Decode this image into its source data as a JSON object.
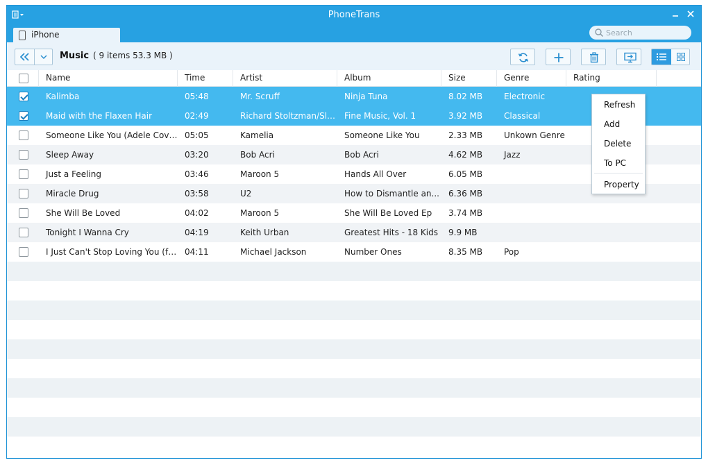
{
  "app": {
    "title": "PhoneTrans"
  },
  "device_tab": {
    "label": "iPhone"
  },
  "search": {
    "placeholder": "Search"
  },
  "toolbar": {
    "title": "Music",
    "info": "( 9 items 53.3 MB )"
  },
  "columns": [
    "Name",
    "Time",
    "Artist",
    "Album",
    "Size",
    "Genre",
    "Rating"
  ],
  "rows": [
    {
      "checked": true,
      "selected": true,
      "name": "Kalimba",
      "time": "05:48",
      "artist": "Mr. Scruff",
      "album": "Ninja Tuna",
      "size": "8.02 MB",
      "genre": "Electronic",
      "rating": ""
    },
    {
      "checked": true,
      "selected": true,
      "name": "Maid with the Flaxen Hair",
      "time": "02:49",
      "artist": "Richard Stoltzman/Slo...",
      "album": "Fine Music, Vol. 1",
      "size": "3.92 MB",
      "genre": "Classical",
      "rating": ""
    },
    {
      "checked": false,
      "selected": false,
      "name": "Someone Like You (Adele Cover)",
      "time": "05:05",
      "artist": "Kamelia",
      "album": "Someone Like You",
      "size": "2.33 MB",
      "genre": "Unkown Genre",
      "rating": ""
    },
    {
      "checked": false,
      "selected": false,
      "name": "Sleep Away",
      "time": "03:20",
      "artist": "Bob Acri",
      "album": "Bob Acri",
      "size": "4.62 MB",
      "genre": "Jazz",
      "rating": ""
    },
    {
      "checked": false,
      "selected": false,
      "name": "Just a Feeling",
      "time": "03:46",
      "artist": "Maroon 5",
      "album": "Hands All Over",
      "size": "6.05 MB",
      "genre": "",
      "rating": ""
    },
    {
      "checked": false,
      "selected": false,
      "name": "Miracle Drug",
      "time": "03:58",
      "artist": "U2",
      "album": "How to Dismantle an...",
      "size": "6.36 MB",
      "genre": "",
      "rating": ""
    },
    {
      "checked": false,
      "selected": false,
      "name": "She Will Be Loved",
      "time": "04:02",
      "artist": "Maroon 5",
      "album": "She Will Be Loved Ep",
      "size": "3.74 MB",
      "genre": "",
      "rating": ""
    },
    {
      "checked": false,
      "selected": false,
      "name": "Tonight I Wanna Cry",
      "time": "04:19",
      "artist": "Keith Urban",
      "album": "Greatest Hits - 18 Kids",
      "size": "9.9 MB",
      "genre": "",
      "rating": ""
    },
    {
      "checked": false,
      "selected": false,
      "name": "I Just Can't Stop Loving You (fea...",
      "time": "04:11",
      "artist": "Michael Jackson",
      "album": "Number Ones",
      "size": "8.35 MB",
      "genre": "Pop",
      "rating": ""
    }
  ],
  "context_menu": {
    "items": [
      "Refresh",
      "Add",
      "Delete",
      "To PC",
      "Property"
    ]
  },
  "colors": {
    "titlebar": "#27a1e2",
    "selection": "#44b9ef",
    "accent": "#2e9be0"
  }
}
